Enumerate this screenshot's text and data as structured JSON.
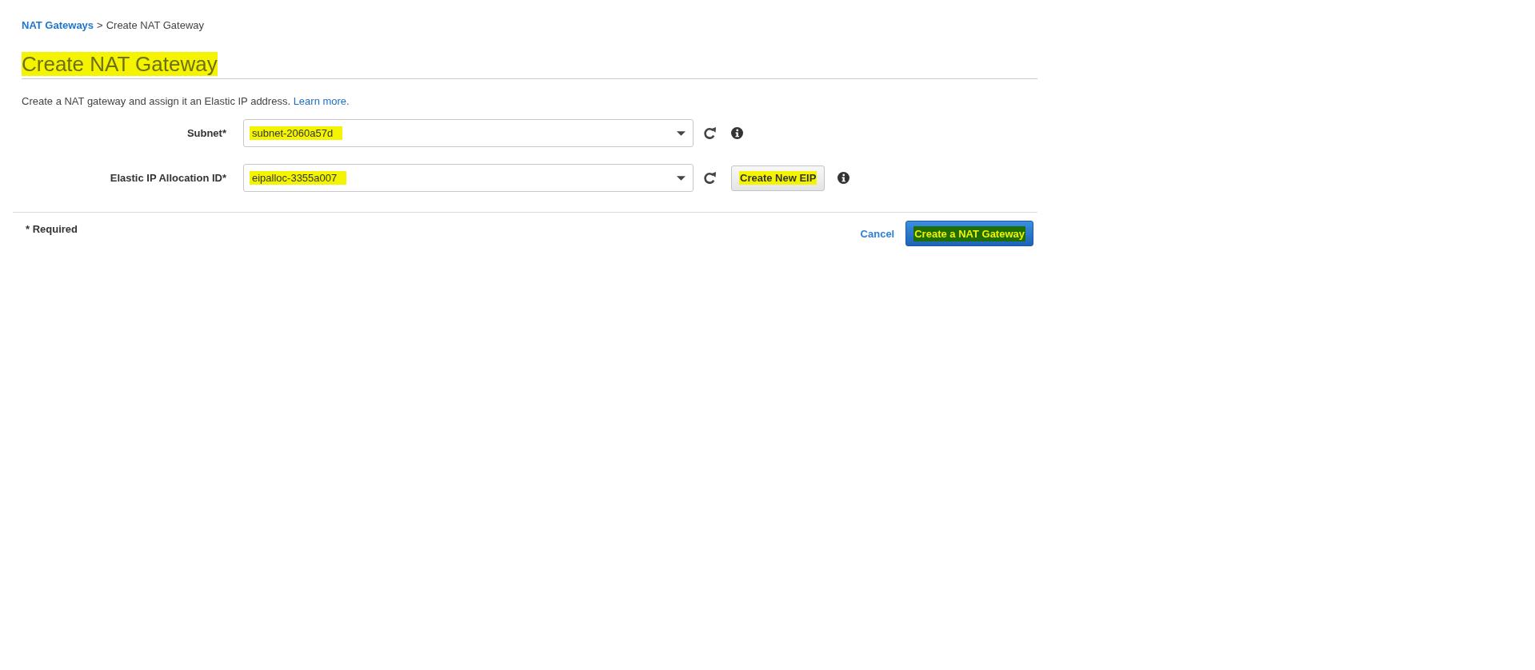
{
  "breadcrumb": {
    "link": "NAT Gateways",
    "separator": ">",
    "current": "Create NAT Gateway"
  },
  "page_title": {
    "text": "Create NAT Gateway",
    "highlighted": true
  },
  "intro": {
    "text": "Create a NAT gateway and assign it an Elastic IP address.",
    "link": "Learn more."
  },
  "form": {
    "fields": [
      {
        "label": "Subnet*",
        "value": "subnet-2060a57d",
        "highlighted": true
      },
      {
        "label": "Elastic IP Allocation ID*",
        "value": "eipalloc-3355a007",
        "highlighted": true,
        "action": {
          "label": "Create New EIP",
          "highlighted": true
        }
      }
    ]
  },
  "footer": {
    "note": "* Required",
    "buttons": [
      {
        "label": "Cancel",
        "kind": "link"
      },
      {
        "label": "Create a NAT Gateway",
        "kind": "primary",
        "highlighted": true
      }
    ]
  }
}
